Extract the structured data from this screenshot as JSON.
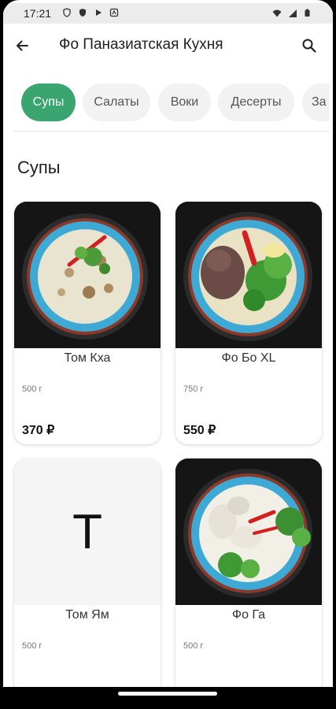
{
  "status": {
    "time": "17:21"
  },
  "appbar": {
    "title": "Фо Паназиатская Кухня"
  },
  "categories": [
    "Супы",
    "Салаты",
    "Воки",
    "Десерты",
    "Закуски"
  ],
  "categories_visible": [
    "Супы",
    "Салаты",
    "Воки",
    "Десерты",
    "За"
  ],
  "section": {
    "title": "Супы"
  },
  "products": [
    {
      "name": "Том Кха",
      "weight": "500 г",
      "price": "370 ₽",
      "image": "soup-tom-kha"
    },
    {
      "name": "Фо Бо XL",
      "weight": "750 г",
      "price": "550 ₽",
      "image": "soup-pho-bo"
    },
    {
      "name": "Том Ям",
      "weight": "500 г",
      "price": "",
      "placeholder": "Т"
    },
    {
      "name": "Фо Га",
      "weight": "500 г",
      "price": "",
      "image": "soup-pho-ga"
    }
  ],
  "colors": {
    "accent": "#3aa56f",
    "chip_bg": "#f2f2f2"
  }
}
